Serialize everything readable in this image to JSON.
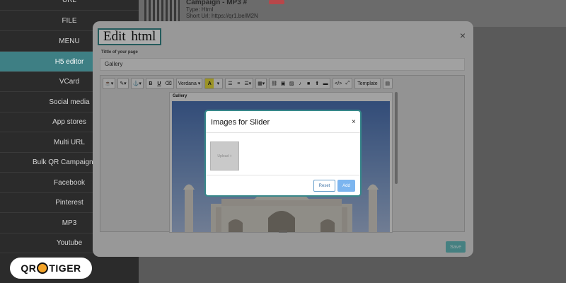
{
  "sidebar": {
    "items": [
      {
        "label": "URL",
        "active": false
      },
      {
        "label": "FILE",
        "active": false
      },
      {
        "label": "MENU",
        "active": false
      },
      {
        "label": "H5 editor",
        "active": true
      },
      {
        "label": "VCard",
        "active": false
      },
      {
        "label": "Social media",
        "active": false
      },
      {
        "label": "App stores",
        "active": false
      },
      {
        "label": "Multi URL",
        "active": false
      },
      {
        "label": "Bulk QR Campaign D",
        "active": false
      },
      {
        "label": "Facebook",
        "active": false
      },
      {
        "label": "Pinterest",
        "active": false
      },
      {
        "label": "MP3",
        "active": false
      },
      {
        "label": "Youtube",
        "active": false
      }
    ]
  },
  "background": {
    "campaign_name": "Campaign - MP3 #",
    "type_label": "Type: Html",
    "short_url_label": "Short Url: https://qr1.be/M2N"
  },
  "logo": {
    "text_left": "QR",
    "text_right": "TIGER"
  },
  "editor_modal": {
    "title": "Edit html",
    "close_icon": "×",
    "page_title_label": "Tittle of your page",
    "page_title_value": "Gallery",
    "toolbar": {
      "font_name": "Verdana",
      "highlight_label": "A",
      "bold": "B",
      "underline": "U",
      "template_label": "Template"
    },
    "canvas_heading": "Gallery",
    "save_label": "Save"
  },
  "slider_dialog": {
    "title": "Images for Slider",
    "close_icon": "×",
    "upload_label": "Upload +",
    "reset_label": "Reset",
    "add_label": "Add"
  },
  "colors": {
    "accent": "#37888a",
    "sidebar_active": "#3e7f84",
    "save_button": "#67bfc0",
    "add_button": "#7cb5ef"
  }
}
